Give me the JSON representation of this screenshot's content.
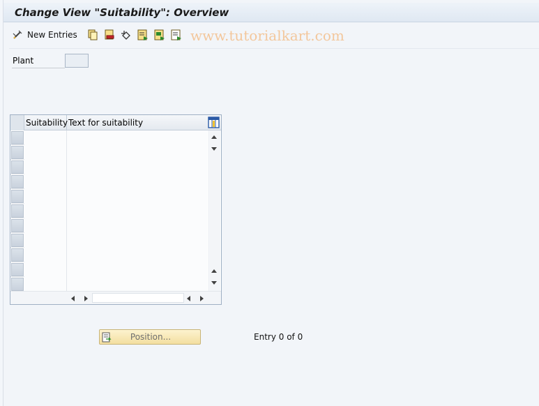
{
  "window": {
    "title": "Change View \"Suitability\": Overview"
  },
  "toolbar": {
    "new_entries_label": "New Entries",
    "icons": [
      "change-display-icon",
      "copy-icon",
      "delete-icon",
      "undo-icon",
      "select-all-icon",
      "select-block-icon",
      "deselect-all-icon"
    ]
  },
  "watermark": "www.tutorialkart.com",
  "selection": {
    "plant_label": "Plant",
    "plant_value": ""
  },
  "table": {
    "columns": [
      "Suitability",
      "Text for suitability"
    ],
    "row_count_visible": 11,
    "rows": []
  },
  "footer": {
    "position_label": "Position...",
    "entry_text": "Entry 0 of 0"
  },
  "colors": {
    "accent_button": "#f3dfa0",
    "watermark": "#f3c79c"
  }
}
